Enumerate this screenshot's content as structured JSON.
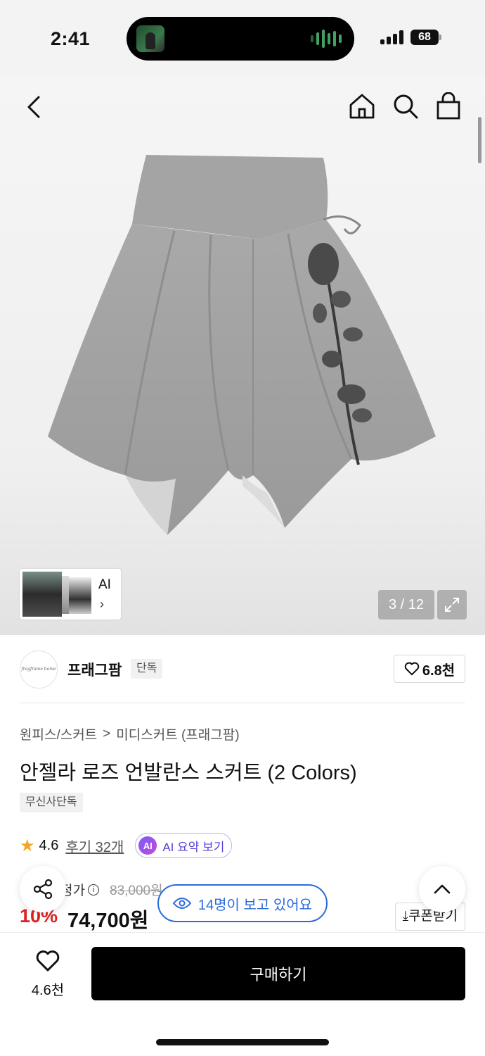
{
  "status_bar": {
    "time": "2:41",
    "battery": "68"
  },
  "hero": {
    "ai_thumb_label": "AI",
    "ai_thumb_chevron": "›",
    "image_counter": "3 / 12"
  },
  "brand": {
    "logo_text": "fragframe home",
    "name": "프래그팜",
    "badge": "단독",
    "likes": "6.8천"
  },
  "product": {
    "breadcrumb": [
      "원피스/스커트",
      "미디스커트 (프래그팜)"
    ],
    "breadcrumb_separator": ">",
    "title": "안젤라 로즈 언발란스 스커트 (2 Colors)",
    "tag": "무신사단독",
    "rating": "4.6",
    "reviews": "후기 32개",
    "ai_chip": "AI",
    "ai_summary": "AI 요약 보기"
  },
  "price": {
    "original_label": "정가",
    "original_price": "83,000원",
    "discount": "10%",
    "sale_price": "74,700원",
    "coupon": "쿠폰받기"
  },
  "overlay": {
    "viewers": "14명이 보고 있어요"
  },
  "bottom_bar": {
    "heart_count": "4.6천",
    "buy_label": "구매하기"
  },
  "colors": {
    "accent_blue": "#2a6bdc",
    "discount_red": "#e02020",
    "ai_purple": "#5a3fd6",
    "star": "#f5a623"
  }
}
